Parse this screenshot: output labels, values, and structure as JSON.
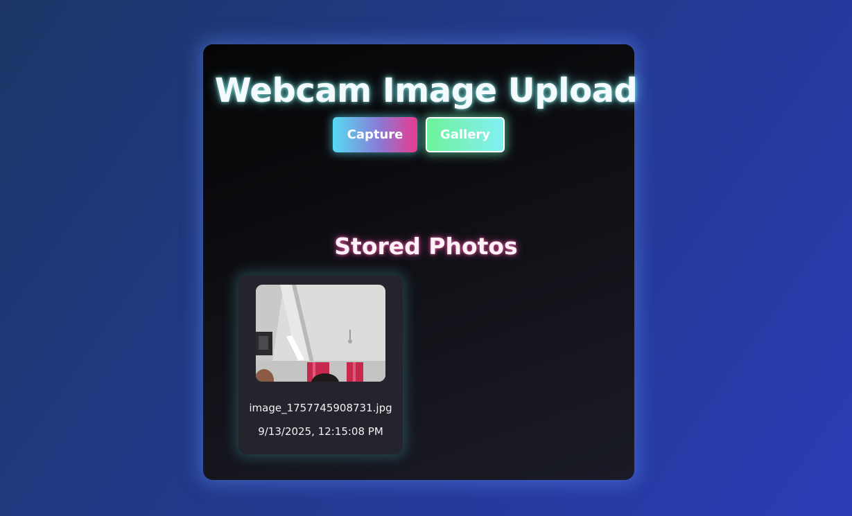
{
  "app": {
    "title": "Webcam Image Upload"
  },
  "toolbar": {
    "capture_label": "Capture",
    "gallery_label": "Gallery"
  },
  "gallery": {
    "heading": "Stored Photos",
    "photos": [
      {
        "filename": "image_1757745908731.jpg",
        "timestamp": "9/13/2025, 12:15:08 PM"
      }
    ]
  },
  "colors": {
    "background": "#22398a",
    "card": "#0f0f14",
    "title_glow": "#8cfaf5",
    "heading_glow": "#f05aaa",
    "capture_gradient_start": "#55dcf2",
    "capture_gradient_end": "#e83a8e",
    "gallery_gradient_start": "#6bf39a",
    "gallery_gradient_end": "#7ff0f2"
  }
}
